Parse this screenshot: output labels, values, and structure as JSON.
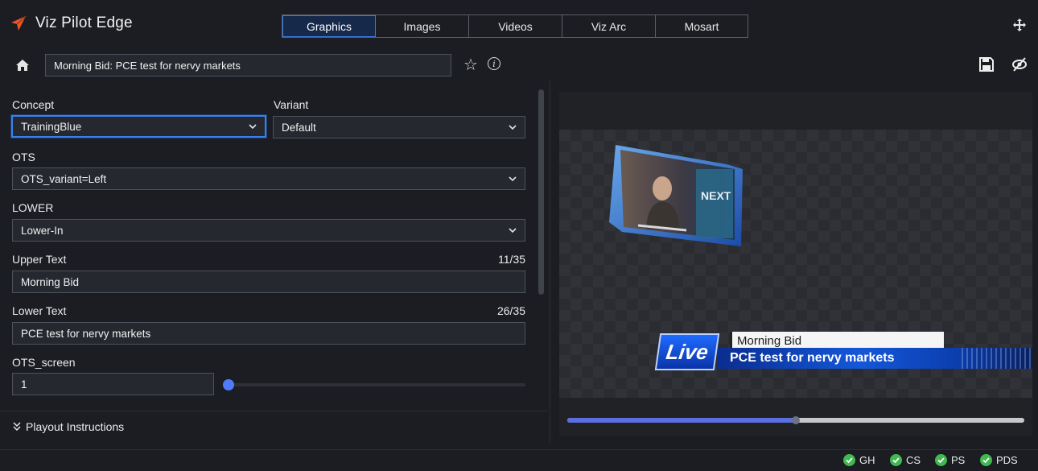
{
  "app": {
    "title": "Viz Pilot Edge",
    "logo_icon": "paper-plane-icon",
    "accent": "#e8562a"
  },
  "tabs": [
    {
      "label": "Graphics",
      "active": true
    },
    {
      "label": "Images",
      "active": false
    },
    {
      "label": "Videos",
      "active": false
    },
    {
      "label": "Viz Arc",
      "active": false
    },
    {
      "label": "Mosart",
      "active": false
    }
  ],
  "toolbar": {
    "home_icon": "home-icon",
    "title_value": "Morning Bid: PCE test for nervy markets",
    "favorite_icon": "star-icon",
    "info_icon": "info-icon",
    "info_glyph": "i",
    "save_icon": "save-icon",
    "visibility_icon": "eye-off-icon",
    "move_icon": "move-icon"
  },
  "form": {
    "concept": {
      "label": "Concept",
      "value": "TrainingBlue"
    },
    "variant": {
      "label": "Variant",
      "value": "Default"
    },
    "ots": {
      "label": "OTS",
      "value": "OTS_variant=Left"
    },
    "lower": {
      "label": "LOWER",
      "value": "Lower-In"
    },
    "upper_text": {
      "label": "Upper Text",
      "value": "Morning Bid",
      "counter": "11/35"
    },
    "lower_text": {
      "label": "Lower Text",
      "value": "PCE test for nervy markets",
      "counter": "26/35"
    },
    "ots_screen": {
      "label": "OTS_screen",
      "value": "1"
    },
    "playout": {
      "label": "Playout Instructions",
      "icon": "chevrons-down-icon"
    }
  },
  "preview": {
    "lower_third_upper": "Morning Bid",
    "lower_third_lower": "PCE test for nervy markets",
    "live_badge": "Live",
    "ots_screen_text": "NEXT",
    "timeline_progress": 0.5
  },
  "status": [
    {
      "label": "GH",
      "state": "ok"
    },
    {
      "label": "CS",
      "state": "ok"
    },
    {
      "label": "PS",
      "state": "ok"
    },
    {
      "label": "PDS",
      "state": "ok"
    }
  ]
}
